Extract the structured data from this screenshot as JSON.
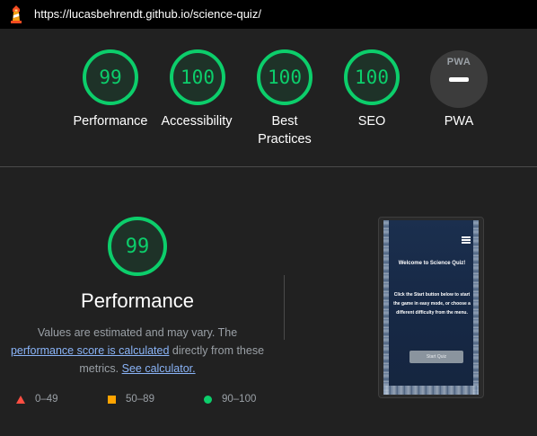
{
  "header": {
    "url": "https://lucasbehrendt.github.io/science-quiz/"
  },
  "categories": [
    {
      "id": "performance",
      "score": "99",
      "label": "Performance"
    },
    {
      "id": "accessibility",
      "score": "100",
      "label": "Accessibility"
    },
    {
      "id": "best-practices",
      "score": "100",
      "label_line1": "Best",
      "label_line2": "Practices"
    },
    {
      "id": "seo",
      "score": "100",
      "label": "SEO"
    },
    {
      "id": "pwa",
      "badge": "PWA",
      "label": "PWA"
    }
  ],
  "performance_section": {
    "score": "99",
    "title": "Performance",
    "desc_part1": "Values are estimated and may vary. The ",
    "link1": "performance score is calculated",
    "desc_part2": " directly from these metrics. ",
    "link2": "See calculator."
  },
  "legend": [
    {
      "shape": "triangle",
      "range": "0–49",
      "color": "#ff4e42"
    },
    {
      "shape": "square",
      "range": "50–89",
      "color": "#ffa400"
    },
    {
      "shape": "circle",
      "range": "90–100",
      "color": "#0cce6b"
    }
  ],
  "screenshot": {
    "title": "Welcome to Science Quiz!",
    "body": "Click the Start button below to start the game in easy mode, or choose a different difficulty from the menu.",
    "button": "Start Quiz"
  },
  "colors": {
    "pass": "#0cce6b",
    "average": "#ffa400",
    "fail": "#ff4e42",
    "background": "#212121"
  }
}
